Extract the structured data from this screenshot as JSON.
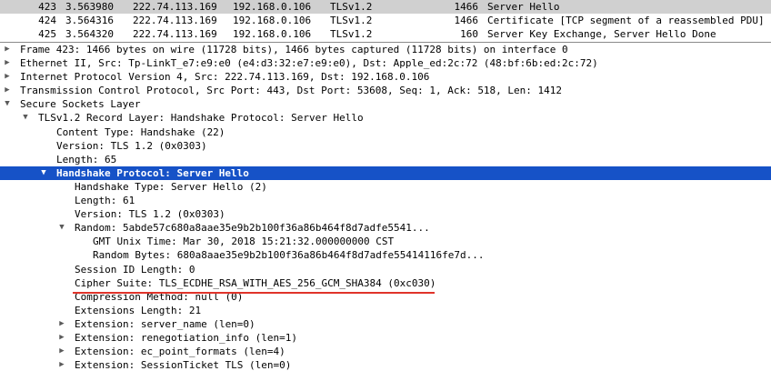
{
  "packet_list": {
    "rows": [
      {
        "no": "423",
        "time": "3.563980",
        "src": "222.74.113.169",
        "dst": "192.168.0.106",
        "proto": "TLSv1.2",
        "len": "1466",
        "info": "Server Hello"
      },
      {
        "no": "424",
        "time": "3.564316",
        "src": "222.74.113.169",
        "dst": "192.168.0.106",
        "proto": "TLSv1.2",
        "len": "1466",
        "info": "Certificate [TCP segment of a reassembled PDU]"
      },
      {
        "no": "425",
        "time": "3.564320",
        "src": "222.74.113.169",
        "dst": "192.168.0.106",
        "proto": "TLSv1.2",
        "len": "160",
        "info": "Server Key Exchange, Server Hello Done"
      }
    ]
  },
  "details": {
    "frame": "Frame 423: 1466 bytes on wire (11728 bits), 1466 bytes captured (11728 bits) on interface 0",
    "ethernet": "Ethernet II, Src: Tp-LinkT_e7:e9:e0 (e4:d3:32:e7:e9:e0), Dst: Apple_ed:2c:72 (48:bf:6b:ed:2c:72)",
    "ip": "Internet Protocol Version 4, Src: 222.74.113.169, Dst: 192.168.0.106",
    "tcp": "Transmission Control Protocol, Src Port: 443, Dst Port: 53608, Seq: 1, Ack: 518, Len: 1412",
    "ssl": "Secure Sockets Layer",
    "record_layer": "TLSv1.2 Record Layer: Handshake Protocol: Server Hello",
    "content_type": "Content Type: Handshake (22)",
    "version": "Version: TLS 1.2 (0x0303)",
    "length": "Length: 65",
    "handshake": "Handshake Protocol: Server Hello",
    "handshake_type": "Handshake Type: Server Hello (2)",
    "hs_length": "Length: 61",
    "hs_version": "Version: TLS 1.2 (0x0303)",
    "random": "Random: 5abde57c680a8aae35e9b2b100f36a86b464f8d7adfe5541...",
    "gmt_time": "GMT Unix Time: Mar 30, 2018 15:21:32.000000000 CST",
    "random_bytes": "Random Bytes: 680a8aae35e9b2b100f36a86b464f8d7adfe55414116fe7d...",
    "session_id_length": "Session ID Length: 0",
    "cipher_suite": "Cipher Suite: TLS_ECDHE_RSA_WITH_AES_256_GCM_SHA384 (0xc030)",
    "compression": "Compression Method: null (0)",
    "ext_length": "Extensions Length: 21",
    "ext_server_name": "Extension: server_name (len=0)",
    "ext_renegotiation": "Extension: renegotiation_info (len=1)",
    "ext_ec_point": "Extension: ec_point_formats (len=4)",
    "ext_session_ticket": "Extension: SessionTicket TLS (len=0)"
  },
  "colors": {
    "selected_row": "#1652c7",
    "packet_selected": "#d0d0d0",
    "highlight_underline": "#e0332a"
  },
  "icons": {
    "collapsed": "triangle-right",
    "expanded": "triangle-down"
  }
}
